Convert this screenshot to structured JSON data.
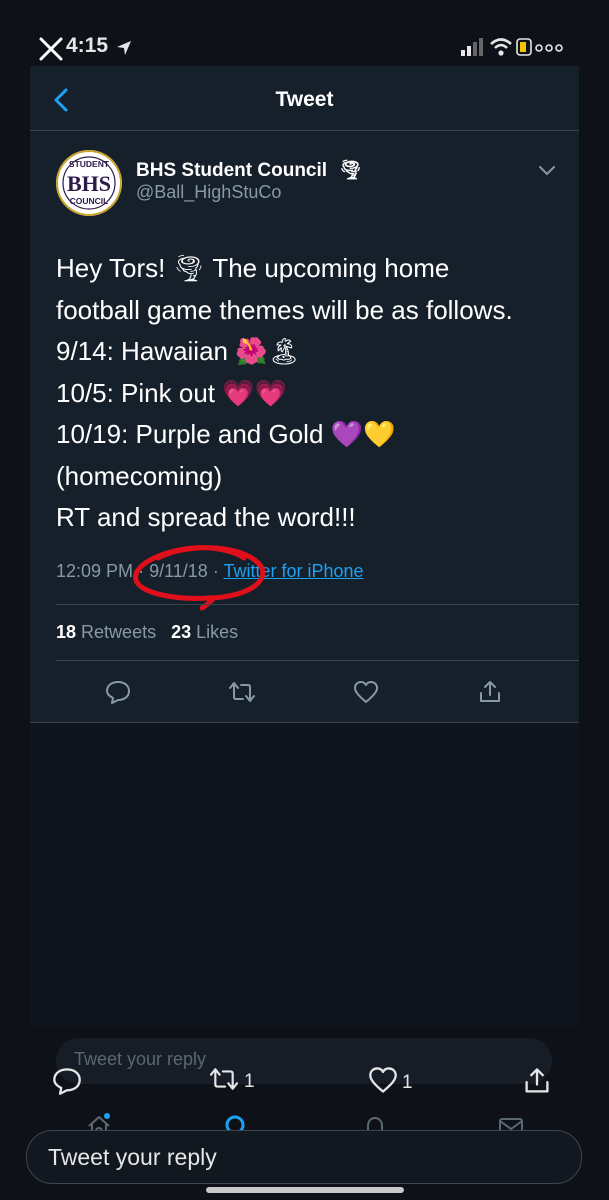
{
  "status_bar": {
    "time": "4:15",
    "icons": [
      "close-icon",
      "location-arrow-icon",
      "signal-icon",
      "wifi-icon",
      "battery-icon"
    ]
  },
  "header": {
    "title": "Tweet",
    "back_icon": "chevron-left-icon"
  },
  "author": {
    "name": "BHS Student Council",
    "handle": "@Ball_HighStuCo",
    "avatar": {
      "top": "STUDENT",
      "middle": "BHS",
      "bottom": "COUNCIL"
    },
    "name_emoji": "🌪"
  },
  "tweet": {
    "lines": [
      "Hey Tors! 🌪 The upcoming home",
      "football game themes will be as follows.",
      "9/14: Hawaiian 🌺🏝",
      "10/5: Pink out 💗💗",
      "10/19: Purple and Gold 💜💛",
      "(homecoming)",
      "RT and spread the word!!!"
    ],
    "time": "12:09 PM",
    "date": "9/11/18",
    "source": "Twitter for iPhone"
  },
  "stats": {
    "retweets_count": "18",
    "retweets_label": "Retweets",
    "likes_count": "23",
    "likes_label": "Likes"
  },
  "actions": [
    "reply-icon",
    "retweet-icon",
    "like-icon",
    "share-icon"
  ],
  "background_tweet": {
    "reply_placeholder": "Tweet your reply",
    "retweet_count": "1",
    "like_count": "1"
  },
  "tab_bar": [
    "home-icon",
    "search-icon",
    "notifications-icon",
    "messages-icon"
  ],
  "reply_box": {
    "placeholder": "Tweet your reply"
  },
  "colors": {
    "background": "#15202b",
    "link": "#1da1f2",
    "secondary_text": "#8899a6",
    "annotation": "#e0101a"
  }
}
